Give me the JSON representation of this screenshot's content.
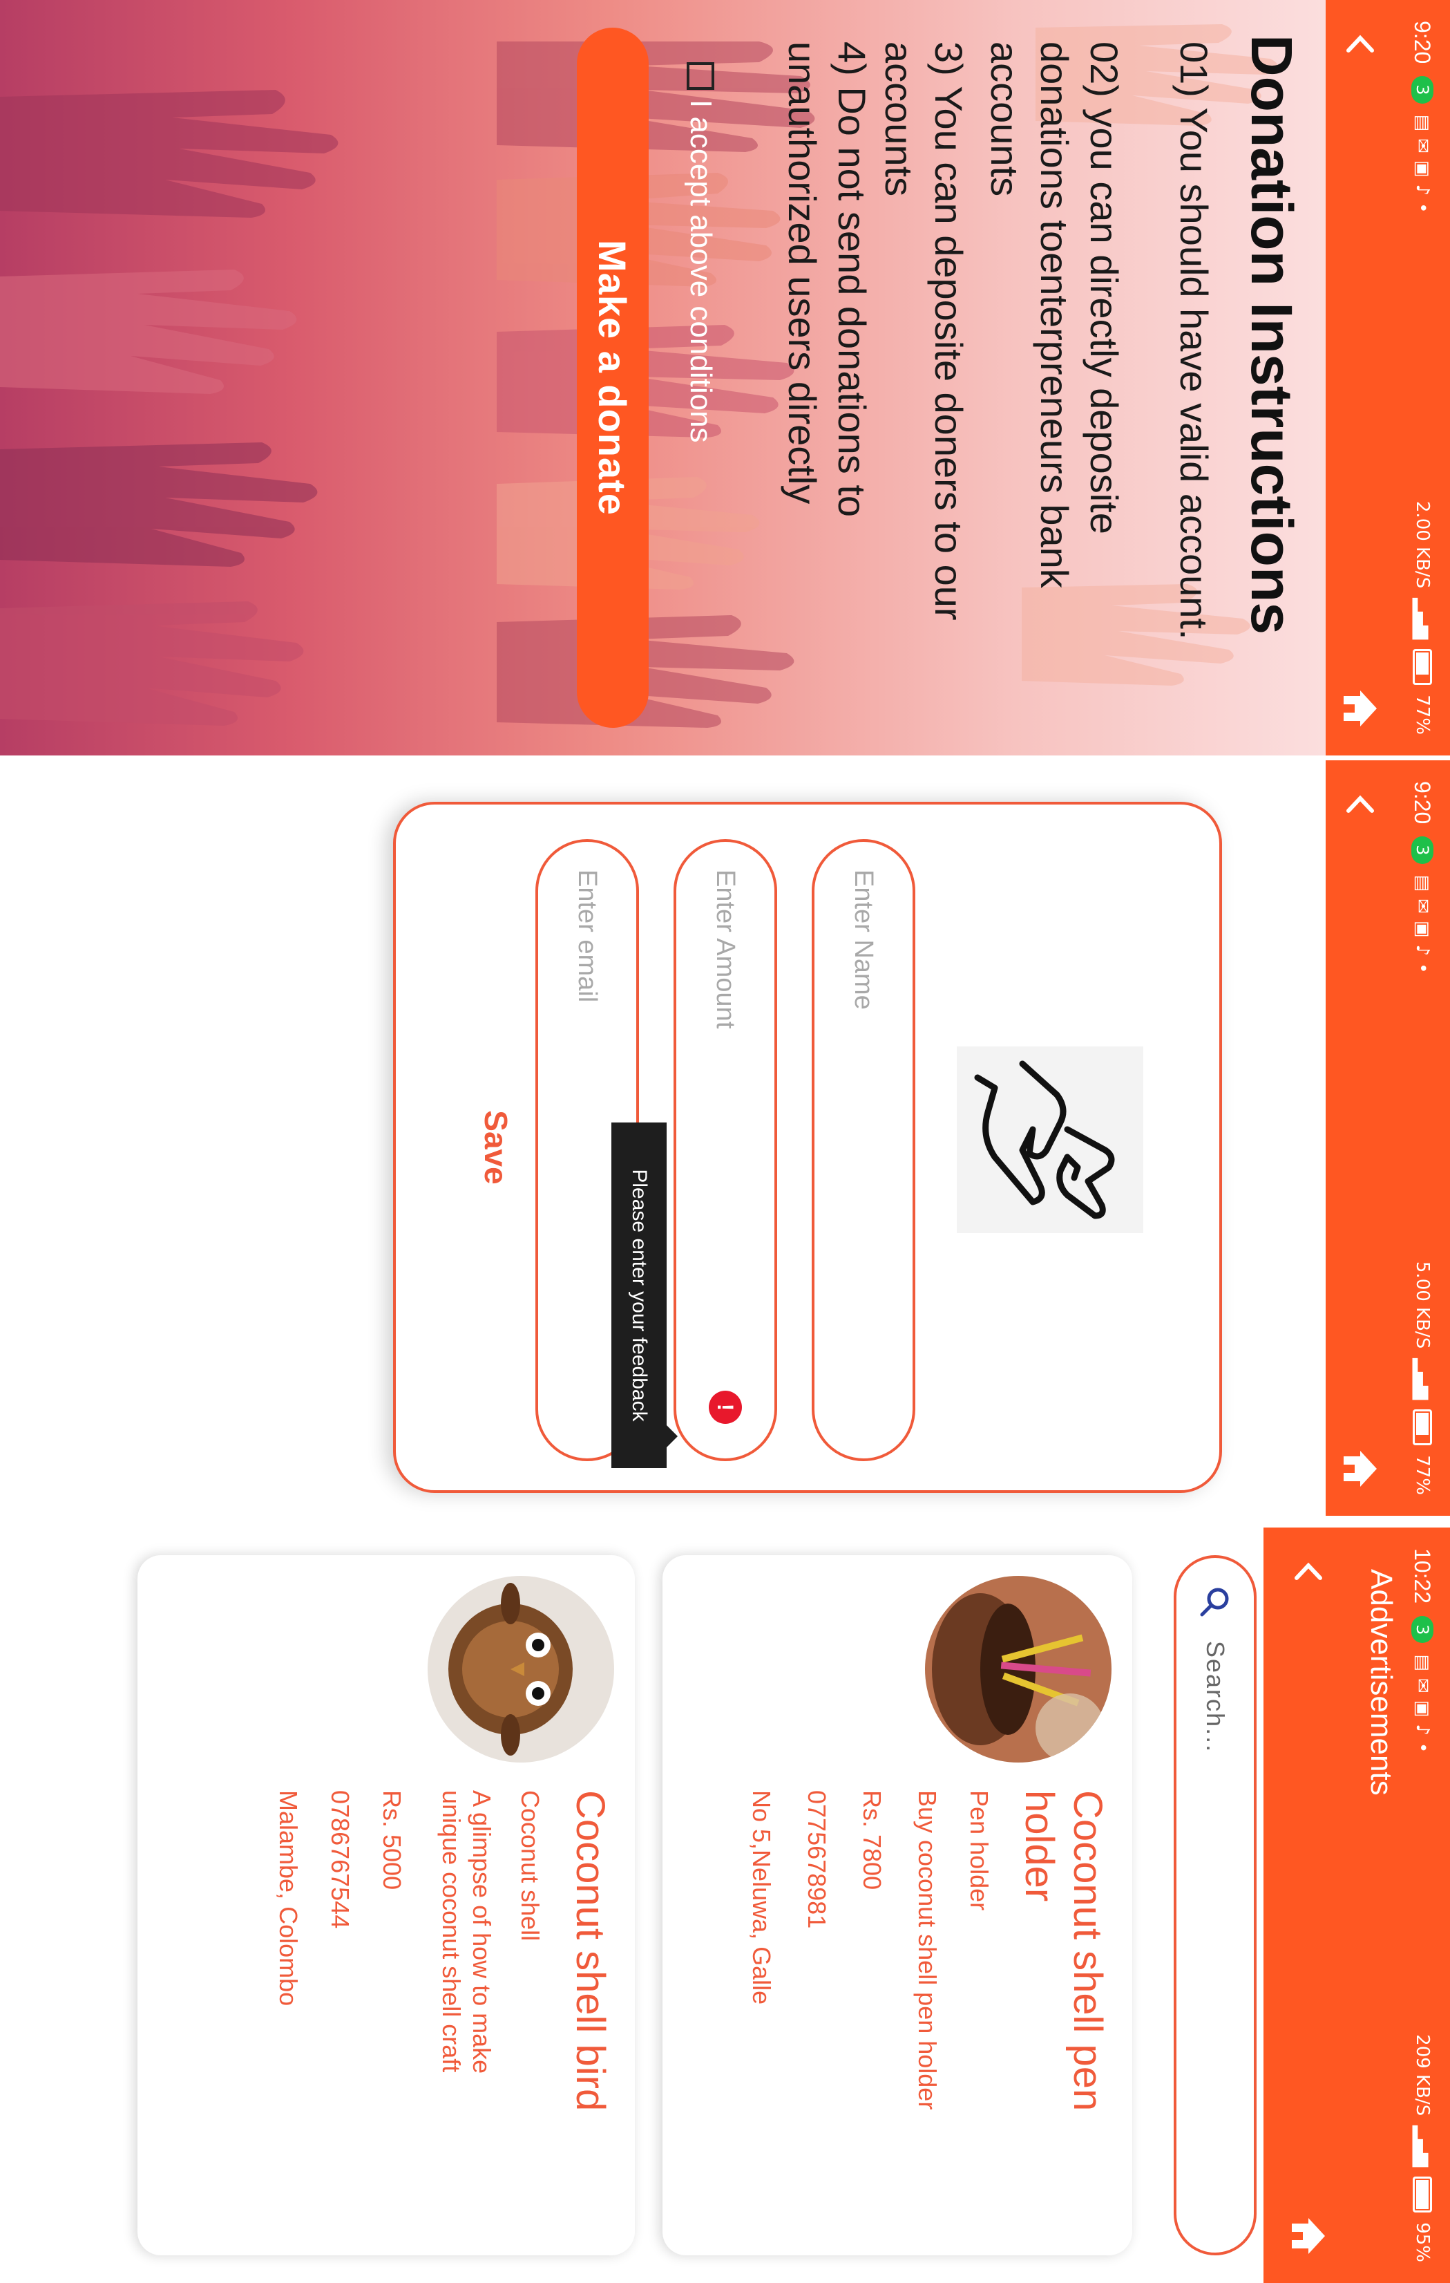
{
  "screen_a": {
    "status": {
      "time": "9:20",
      "wifi_badge": "3",
      "speed": "2.00 KB/S",
      "battery": "77%"
    },
    "title": "Donation Instructions",
    "instructions": [
      "01) You should have valid account.",
      "02) you can directly deposite donations toenterpreneurs bank accounts",
      "3) You can deposite doners to our accounts",
      "4) Do not send donations to unauthorized users directly"
    ],
    "accept_label": "I accept above conditions",
    "donate_button": "Make a donate"
  },
  "screen_b": {
    "status": {
      "time": "9:20",
      "wifi_badge": "3",
      "speed": "5.00 KB/S",
      "battery": "77%"
    },
    "name_placeholder": "Enter Name",
    "amount_placeholder": "Enter Amount",
    "email_placeholder": "Enter email",
    "error_mark": "!",
    "tooltip": "Please enter your feedback",
    "save_label": "Save"
  },
  "screen_c": {
    "status": {
      "time": "10:22",
      "wifi_badge": "3",
      "speed": "209 KB/S",
      "battery": "95%"
    },
    "title": "Addvertisements",
    "search_placeholder": "Search...",
    "ads": [
      {
        "title": "Coconut shell pen holder",
        "category": "Pen holder",
        "description": "Buy coconut shell pen holder",
        "price": "Rs. 7800",
        "phone": "0775678981",
        "address": "No 5,Neluwa, Galle"
      },
      {
        "title": "Coconut shell bird",
        "category": "Coconut shell",
        "description": "A glimpse of how to make unique coconut shell craft",
        "price": "Rs. 5000",
        "phone": "0786767544",
        "address": "Malambe, Colombo"
      }
    ]
  },
  "colors": {
    "accent": "#ff5722",
    "card_border": "#f05a3a",
    "error": "#e8182c",
    "wifi_badge": "#1ec04a"
  }
}
